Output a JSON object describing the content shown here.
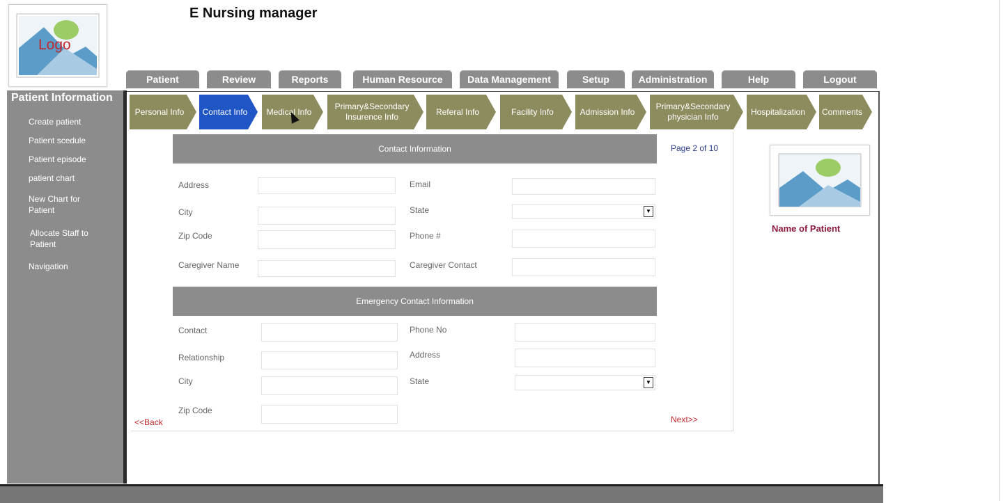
{
  "header": {
    "title": "E Nursing manager",
    "logo_text": "Logo"
  },
  "topnav": [
    "Patient",
    "Review",
    "Reports",
    "Human Resource",
    "Data Management",
    "Setup",
    "Administration",
    "Help",
    "Logout"
  ],
  "sidebar": {
    "title": "Patient Information",
    "items": [
      "Create patient",
      "Patient scedule",
      "Patient episode",
      "patient chart",
      "New Chart for Patient",
      "Allocate Staff to Patient",
      "Navigation"
    ]
  },
  "tabs": [
    "Personal Info",
    "Contact Info",
    "Medical Info",
    "Primary&Secondary Insurence Info",
    "Referal Info",
    "Facility Info",
    "Admission Info",
    "Primary&Secondary physician Info",
    "Hospitalization",
    "Comments"
  ],
  "active_tab": "Contact Info",
  "contact": {
    "title": "Contact Information",
    "address": "Address",
    "email": "Email",
    "city": "City",
    "state": "State",
    "zip": "Zip Code",
    "phone": "Phone #",
    "caregiver_name": "Caregiver Name",
    "caregiver_contact": "Caregiver Contact"
  },
  "emergency": {
    "title": "Emergency Contact Information",
    "contact": "Contact",
    "phone": "Phone No",
    "relationship": "Relationship",
    "address": "Address",
    "city": "City",
    "state": "State",
    "zip": "Zip Code"
  },
  "pager": {
    "page": "Page 2 of 10",
    "back": "<<Back",
    "next": "Next>>"
  },
  "patient": {
    "name": "Name of Patient"
  },
  "colors": {
    "tab": "#8d8c5e",
    "tab_active": "#1f55c4",
    "nav": "#8c8c8c",
    "accent_red": "#c0282d"
  }
}
